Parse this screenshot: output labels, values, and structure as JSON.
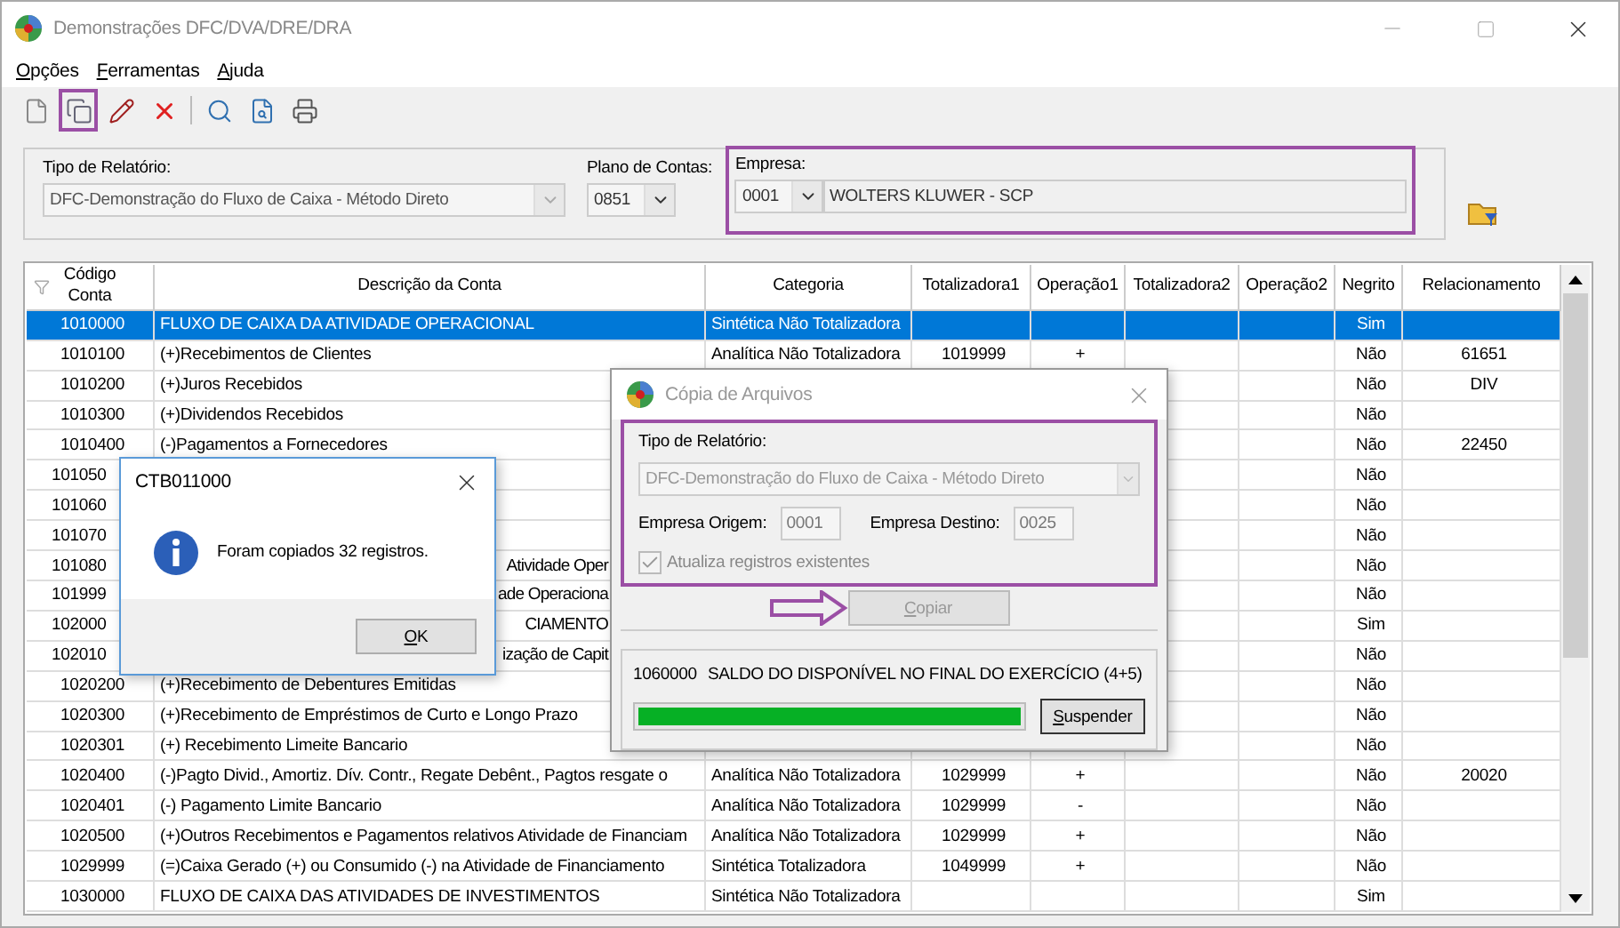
{
  "window": {
    "title": "Demonstrações DFC/DVA/DRE/DRA"
  },
  "menu": [
    "Opções",
    "Ferramentas",
    "Ajuda"
  ],
  "toolbar": [
    {
      "kind": "new",
      "highlighted": false
    },
    {
      "kind": "copy",
      "highlighted": true
    },
    {
      "kind": "edit",
      "highlighted": false
    },
    {
      "kind": "delete",
      "highlighted": false
    },
    {
      "kind": "separator"
    },
    {
      "kind": "search",
      "highlighted": false
    },
    {
      "kind": "preview",
      "highlighted": false
    },
    {
      "kind": "print",
      "highlighted": false
    }
  ],
  "filters": {
    "report_type": {
      "label": "Tipo de Relatório:",
      "value": "DFC-Demonstração do Fluxo de Caixa - Método Direto"
    },
    "chart_of_accounts": {
      "label": "Plano de Contas:",
      "value": "0851"
    },
    "company": {
      "label": "Empresa:",
      "code": "0001",
      "name": "WOLTERS KLUWER - SCP",
      "highlighted": true
    }
  },
  "table": {
    "columns": [
      "Código Conta",
      "Descrição da Conta",
      "Categoria",
      "Totalizadora1",
      "Operação1",
      "Totalizadora2",
      "Operação2",
      "Negrito",
      "Relacionamento"
    ],
    "rows": [
      {
        "kind": "full",
        "code": "1010000",
        "description": "FLUXO DE CAIXA DA ATIVIDADE OPERACIONAL",
        "category": "Sintética Não Totalizadora",
        "negrito": "Sim",
        "selected": true
      },
      {
        "kind": "full",
        "code": "1010100",
        "description": "(+)Recebimentos de Clientes",
        "category": "Analítica Não Totalizadora",
        "total1": "1019999",
        "op1": "+",
        "negrito": "Não",
        "relation": "61651",
        "selected": false
      },
      {
        "kind": "full",
        "code": "1010200",
        "description": "(+)Juros Recebidos",
        "negrito": "Não",
        "relation": "DIV",
        "selected": false
      },
      {
        "kind": "full",
        "code": "1010300",
        "description": "(+)Dividendos Recebidos",
        "negrito": "Não",
        "selected": false
      },
      {
        "kind": "full",
        "code": "1010400",
        "description": "(-)Pagamentos a Fornecedores",
        "negrito": "Não",
        "relation": "22450",
        "selected": false
      },
      {
        "kind": "partly-hidden",
        "code": "101050",
        "negrito": "Não",
        "selected": false
      },
      {
        "kind": "partly-hidden",
        "code": "101060",
        "negrito": "Não",
        "selected": false
      },
      {
        "kind": "partly-hidden",
        "code": "101070",
        "negrito": "Não",
        "selected": false
      },
      {
        "kind": "partly-hidden",
        "code": "101080",
        "description": "Atividade Oper",
        "negrito": "Não",
        "selected": false
      },
      {
        "kind": "partly-hidden",
        "code": "101999",
        "description": "ade Operaciona",
        "negrito": "Não",
        "selected": false
      },
      {
        "kind": "partly-hidden",
        "code": "102000",
        "description": "CIAMENTO",
        "negrito": "Sim",
        "selected": false
      },
      {
        "kind": "partly-hidden",
        "code": "102010",
        "description": "ização de Capit",
        "negrito": "Não",
        "selected": false
      },
      {
        "kind": "full",
        "code": "1020200",
        "description": "(+)Recebimento de Debentures Emitidas",
        "negrito": "Não",
        "selected": false
      },
      {
        "kind": "full",
        "code": "1020300",
        "description": "(+)Recebimento de Empréstimos de Curto e Longo Prazo",
        "negrito": "Não",
        "selected": false
      },
      {
        "kind": "full",
        "code": "1020301",
        "description": "(+) Recebimento Limeite Bancario",
        "negrito": "Não",
        "selected": false
      },
      {
        "kind": "full",
        "code": "1020400",
        "description": "(-)Pagto Divid., Amortiz. Dív. Contr., Regate Debênt., Pagtos resgate o",
        "category": "Analítica Não Totalizadora",
        "total1": "1029999",
        "op1": "+",
        "negrito": "Não",
        "relation": "20020",
        "selected": false
      },
      {
        "kind": "full",
        "code": "1020401",
        "description": "(-) Pagamento Limite Bancario",
        "category": "Analítica Não Totalizadora",
        "total1": "1029999",
        "op1": "-",
        "negrito": "Não",
        "selected": false
      },
      {
        "kind": "full",
        "code": "1020500",
        "description": "(+)Outros Recebimentos e Pagamentos relativos Atividade de Financiam",
        "category": "Analítica Não Totalizadora",
        "total1": "1029999",
        "op1": "+",
        "negrito": "Não",
        "selected": false
      },
      {
        "kind": "full",
        "code": "1029999",
        "description": "(=)Caixa Gerado (+) ou Consumido (-) na Atividade de Financiamento",
        "category": "Sintética Totalizadora",
        "total1": "1049999",
        "op1": "+",
        "negrito": "Não",
        "selected": false
      },
      {
        "kind": "full",
        "code": "1030000",
        "description": "FLUXO DE CAIXA DAS ATIVIDADES DE INVESTIMENTOS",
        "category": "Sintética Não Totalizadora",
        "negrito": "Sim",
        "selected": false
      }
    ]
  },
  "copy_dialog": {
    "title": "Cópia de Arquivos",
    "highlighted": true,
    "report_label": "Tipo de Relatório:",
    "report_value": "DFC-Demonstração do Fluxo de Caixa - Método Direto",
    "source_label": "Empresa Origem:",
    "source": "0001",
    "target_label": "Empresa Destino:",
    "target": "0025",
    "update_existing": {
      "label": "Atualiza registros existentes",
      "checked": true
    },
    "copy_button": {
      "label": "Copiar",
      "disabled": true,
      "annotated": true
    },
    "progress": {
      "code": "1060000",
      "text": "SALDO DO DISPONÍVEL NO FINAL DO EXERCÍCIO (4+5)",
      "level": 1
    },
    "suspend_button": "Suspender"
  },
  "message_box": {
    "title": "CTB011000",
    "message": "Foram copiados 32 registros.",
    "button": "OK"
  }
}
